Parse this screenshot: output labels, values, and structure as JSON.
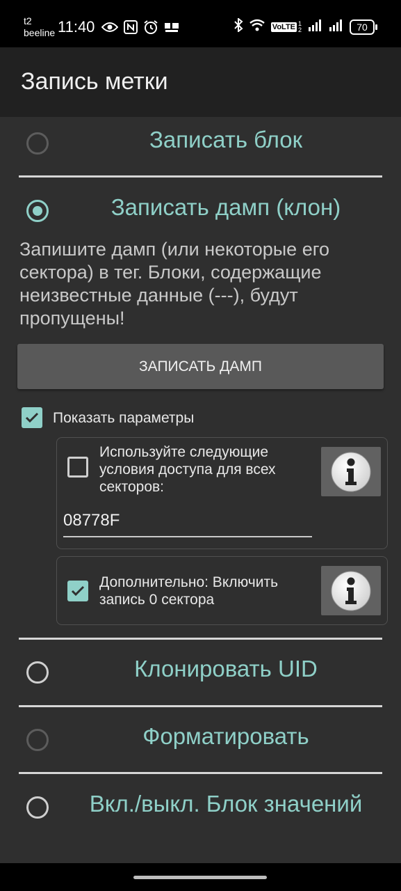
{
  "status": {
    "carrier_line1": "t2",
    "carrier_line2": "beeline",
    "time": "11:40",
    "volte": "VoLTE",
    "volte_sim": "1 2",
    "battery": "70"
  },
  "app": {
    "title": "Запись метки"
  },
  "options": {
    "write_block": "Записать блок",
    "write_dump": "Записать дамп (клон)",
    "clone_uid": "Клонировать UID",
    "format": "Форматировать",
    "value_block": "Вкл./выкл. Блок значений"
  },
  "dump": {
    "description": "Запишите дамп (или некоторые его сектора) в тег. Блоки, содержащие неизвестные данные (---), будут пропущены!",
    "button": "ЗАПИСАТЬ ДАМП",
    "show_params": "Показать параметры",
    "access_label": "Используйте следующие условия доступа для всех секторов:",
    "access_value": "08778F",
    "sector0_label": "Дополнительно: Включить запись 0 сектора"
  },
  "state": {
    "selected_option": "write_dump",
    "show_params_checked": true,
    "access_checked": false,
    "sector0_checked": true
  },
  "colors": {
    "accent": "#8fd0c8",
    "background": "#2f2f2f",
    "appbar": "#212121"
  }
}
